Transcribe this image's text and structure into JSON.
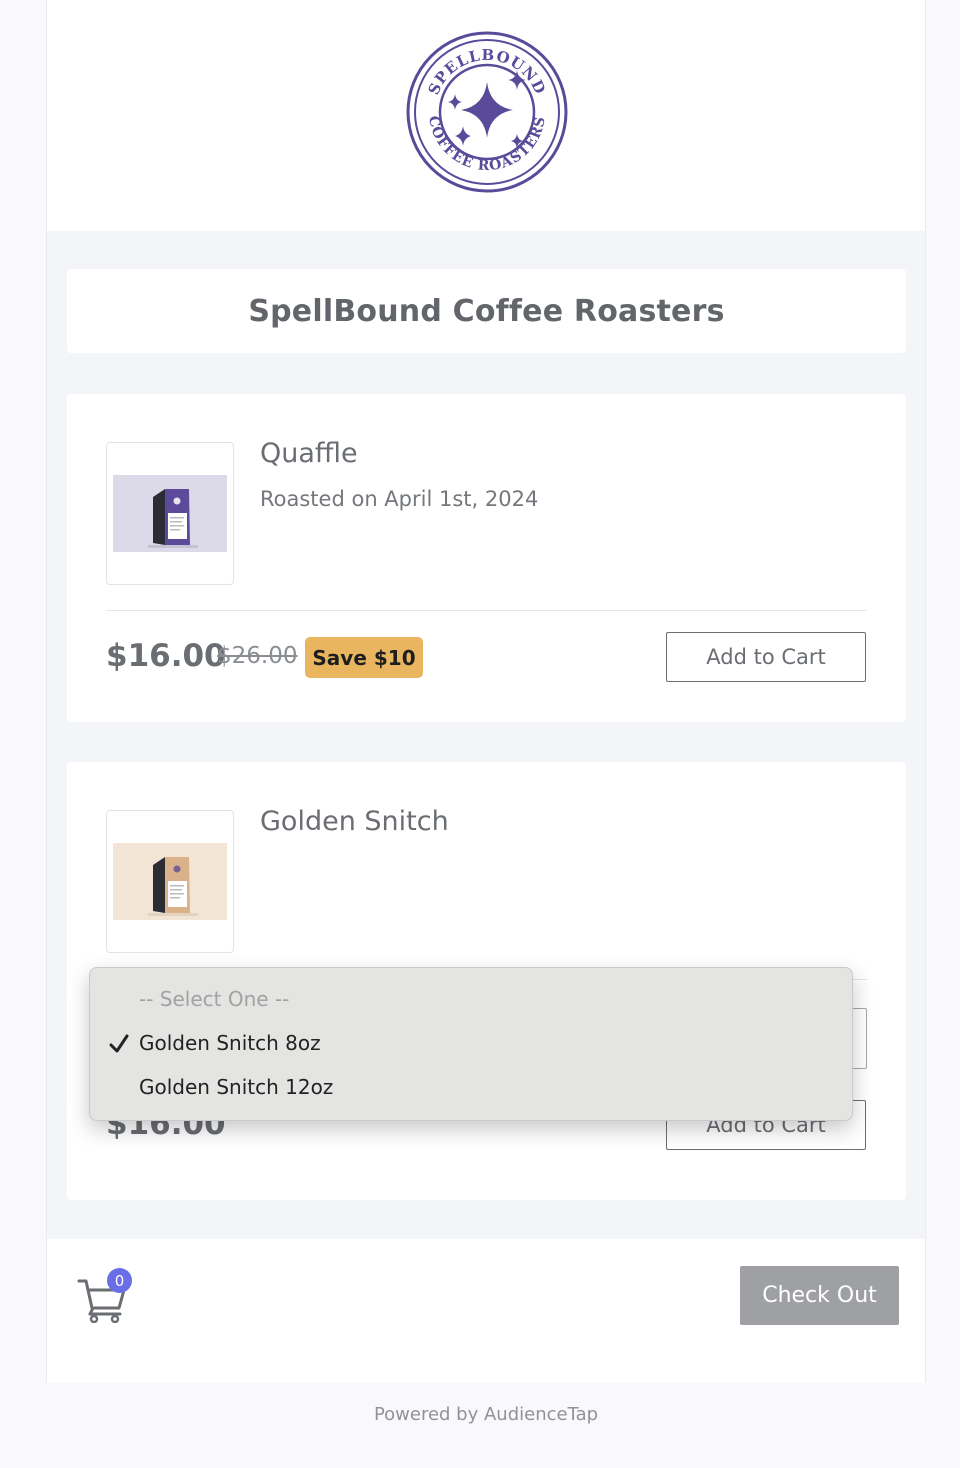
{
  "brand": {
    "logo_text_top": "SPELLBOUND",
    "logo_text_bottom": "COFFEE ROASTERS",
    "logo_color": "#5a4b9a",
    "shop_title": "SpellBound Coffee Roasters"
  },
  "products": [
    {
      "name": "Quaffle",
      "roasted": "Roasted on April 1st, 2024",
      "price": "$16.00",
      "old_price": "$26.00",
      "save_label": "Save $10",
      "add_label": "Add to Cart",
      "image_bg": "#dcd9e8",
      "bag_color": "#5c4b9a"
    },
    {
      "name": "Golden Snitch",
      "price": "$16.00",
      "add_label": "Add to Cart",
      "image_bg": "#f2e5d6",
      "bag_color": "#d9b289"
    }
  ],
  "variant_dropdown": {
    "placeholder": "-- Select One --",
    "options": [
      "Golden Snitch 8oz",
      "Golden Snitch 12oz"
    ],
    "selected": "Golden Snitch 8oz"
  },
  "cart": {
    "count": "0",
    "checkout_label": "Check Out"
  },
  "footer": {
    "powered_by": "Powered by AudienceTap"
  }
}
